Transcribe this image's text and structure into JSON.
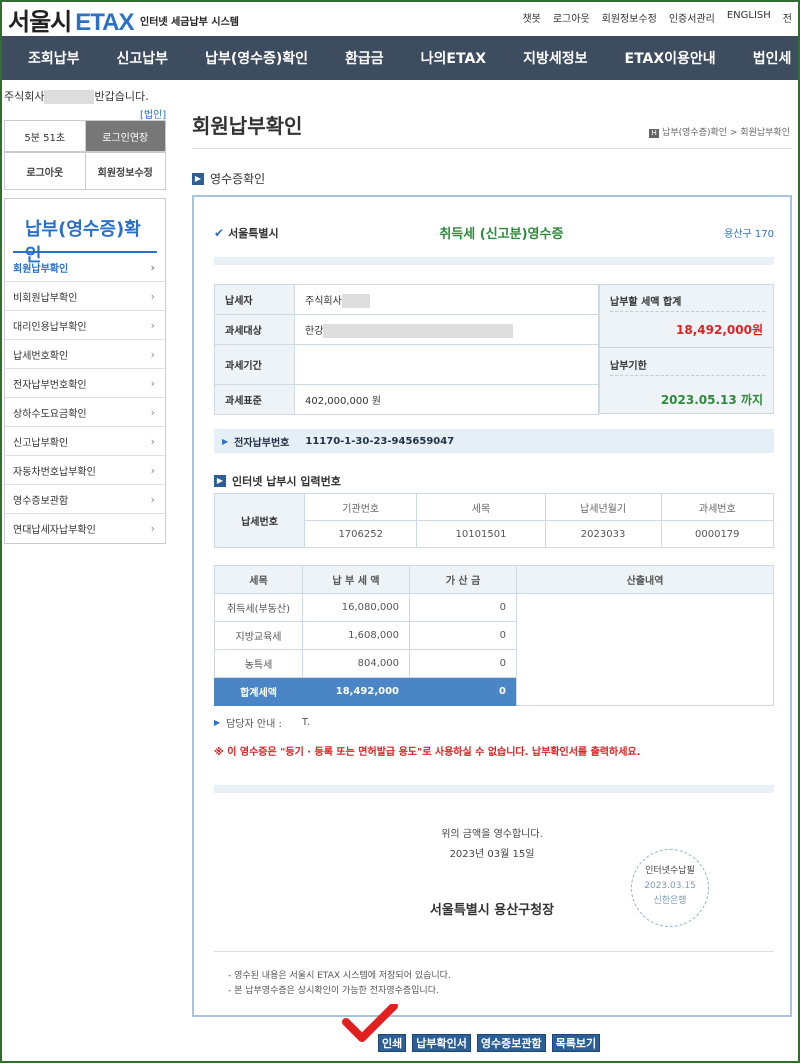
{
  "header": {
    "logo_main": "서울시",
    "logo_etax": "ETAX",
    "logo_sub": "인터넷 세금납부 시스템",
    "util_links": [
      "챗봇",
      "로그아웃",
      "회원정보수정",
      "인증서관리",
      "ENGLISH",
      "전"
    ]
  },
  "nav": {
    "items": [
      "조회납부",
      "신고납부",
      "납부(영수증)확인",
      "환급금",
      "나의ETAX",
      "지방세정보",
      "ETAX이용안내",
      "법인세"
    ]
  },
  "sidebar": {
    "greeting_prefix": "주식회사",
    "greeting_suffix": "반갑습니다.",
    "badge": "[법인]",
    "timer": "5분 51초",
    "extend_label": "로그인연장",
    "logout_label": "로그아웃",
    "profile_label": "회원정보수정",
    "menu_title": "납부(영수증)확인",
    "items": [
      "회원납부확인",
      "비회원납부확인",
      "대리인용납부확인",
      "납세번호확인",
      "전자납부번호확인",
      "상하수도요금확인",
      "신고납부확인",
      "자동차번호납부확인",
      "영수증보관함",
      "연대납세자납부확인"
    ]
  },
  "main": {
    "page_title": "회원납부확인",
    "breadcrumb": "납부(영수증)확인 > 회원납부확인",
    "section_label": "영수증확인"
  },
  "receipt": {
    "city": "서울특별시",
    "title": "취득세 (신고분)영수증",
    "gu": "용산구 170",
    "labels": {
      "taxpayer": "납세자",
      "object": "과세대상",
      "period": "과세기간",
      "standard": "과세표준",
      "sum_label": "납부할 세액 합계",
      "due_label": "납부기한"
    },
    "taxpayer_name": "주식회사",
    "object_value": "한강",
    "period_value": "",
    "standard_value": "402,000,000 원",
    "sum_value": "18,492,000원",
    "due_value": "2023.05.13 까지",
    "epay_label": "전자납부번호",
    "epay_number": "11170-1-30-23-945659047",
    "inet_label": "인터넷 납부시 입력번호",
    "taxno": {
      "row_label": "납세번호",
      "headers": [
        "기관번호",
        "세목",
        "납세년월기",
        "과세번호"
      ],
      "values": [
        "1706252",
        "10101501",
        "2023033",
        "0000179"
      ]
    },
    "amounts": {
      "headers": [
        "세목",
        "납 부 세 액",
        "가 산 금",
        "산출내역"
      ],
      "rows": [
        {
          "name": "취득세(부동산)",
          "amount": "16,080,000",
          "extra": "0"
        },
        {
          "name": "지방교육세",
          "amount": "1,608,000",
          "extra": "0"
        },
        {
          "name": "농특세",
          "amount": "804,000",
          "extra": "0"
        }
      ],
      "total": {
        "name": "합계세액",
        "amount": "18,492,000",
        "extra": "0"
      }
    },
    "contact_label": "담당자 안내 :",
    "contact_value": "T.",
    "warning": "※ 이 영수증은 \"등기 · 등록 또는 면허발급 용도\"로 사용하실 수 없습니다. 납부확인서를 출력하세요.",
    "received_msg": "위의 금액을 영수합니다.",
    "received_date": "2023년 03월 15일",
    "issuer": "서울특별시 용산구청장",
    "stamp": {
      "line1": "인터넷수납필",
      "line2": "2023.03.15",
      "line3": "신한은행"
    },
    "notes": [
      "- 영수된 내용은 서울시 ETAX 시스템에 저장되어 있습니다.",
      "- 본 납부영수증은 상시확인이 가능한 전자영수증입니다."
    ]
  },
  "buttons": [
    "인쇄",
    "납부확인서",
    "영수증보관함",
    "목록보기"
  ]
}
